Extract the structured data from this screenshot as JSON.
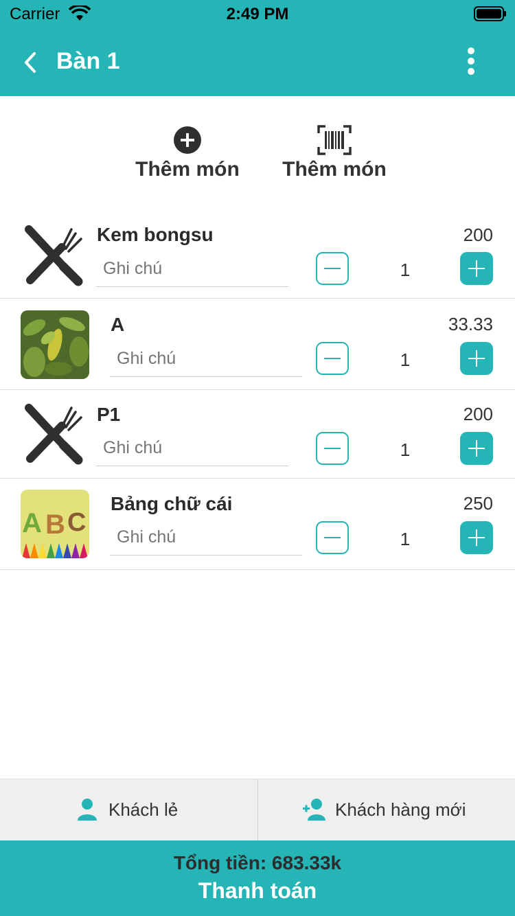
{
  "status_bar": {
    "carrier": "Carrier",
    "time": "2:49 PM"
  },
  "header": {
    "title": "Bàn 1"
  },
  "actions": [
    {
      "label": "Thêm món",
      "icon": "add-circle-icon"
    },
    {
      "label": "Thêm món",
      "icon": "barcode-scan-icon"
    }
  ],
  "items": [
    {
      "name": "Kem bongsu",
      "note_placeholder": "Ghi chú",
      "price": "200",
      "qty": "1",
      "thumb": "utensils-icon"
    },
    {
      "name": "A",
      "note_placeholder": "Ghi chú",
      "price": "33.33",
      "qty": "1",
      "thumb": "leaf-photo"
    },
    {
      "name": "P1",
      "note_placeholder": "Ghi chú",
      "price": "200",
      "qty": "1",
      "thumb": "utensils-icon"
    },
    {
      "name": "Bảng chữ cái",
      "note_placeholder": "Ghi chú",
      "price": "250",
      "qty": "1",
      "thumb": "abc-photo"
    }
  ],
  "customer": {
    "retail_label": "Khách lẻ",
    "new_label": "Khách hàng mới"
  },
  "footer": {
    "total": "Tổng tiền: 683.33k",
    "pay_label": "Thanh toán"
  },
  "colors": {
    "accent": "#26b5b6"
  }
}
